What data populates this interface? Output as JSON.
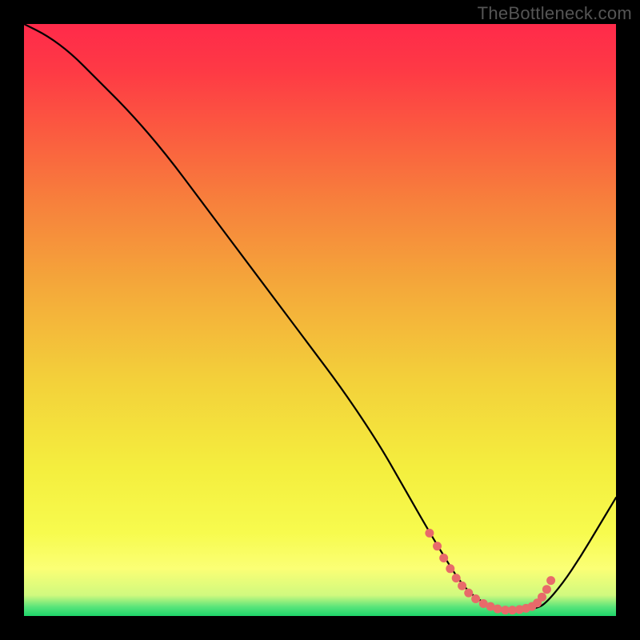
{
  "watermark": "TheBottleneck.com",
  "chart_data": {
    "type": "line",
    "title": "",
    "xlabel": "",
    "ylabel": "",
    "xlim": [
      0,
      100
    ],
    "ylim": [
      0,
      100
    ],
    "background": {
      "stops": [
        {
          "t": 0.0,
          "color": "#ff2a4a"
        },
        {
          "t": 0.08,
          "color": "#fe3a45"
        },
        {
          "t": 0.18,
          "color": "#fb5a40"
        },
        {
          "t": 0.3,
          "color": "#f7803c"
        },
        {
          "t": 0.45,
          "color": "#f4aa3a"
        },
        {
          "t": 0.6,
          "color": "#f3d03a"
        },
        {
          "t": 0.75,
          "color": "#f4ee3e"
        },
        {
          "t": 0.86,
          "color": "#f7fb4e"
        },
        {
          "t": 0.92,
          "color": "#fbff75"
        },
        {
          "t": 0.965,
          "color": "#d0f97f"
        },
        {
          "t": 0.985,
          "color": "#57e47a"
        },
        {
          "t": 1.0,
          "color": "#1ed56a"
        }
      ]
    },
    "curve": {
      "color": "#000000",
      "width": 2.2,
      "x": [
        0,
        4,
        8,
        12,
        18,
        24,
        30,
        36,
        42,
        48,
        54,
        60,
        64,
        68,
        71,
        73.5,
        76,
        79,
        82,
        84.5,
        86.5,
        88,
        91,
        94,
        97,
        100
      ],
      "y": [
        100,
        98,
        95,
        91,
        85,
        78,
        70,
        62,
        54,
        46,
        38,
        29,
        22,
        15,
        10,
        6,
        3.2,
        1.6,
        1.0,
        1.0,
        1.3,
        2.0,
        5.5,
        10,
        15,
        20
      ]
    },
    "valley_dots": {
      "color": "#e86a6a",
      "radius": 5.5,
      "points_x": [
        68.5,
        69.8,
        70.9,
        72.0,
        73.0,
        74.0,
        75.1,
        76.3,
        77.6,
        78.8,
        80.0,
        81.3,
        82.5,
        83.7,
        84.8,
        85.8,
        86.7,
        87.5,
        88.3,
        89.0
      ],
      "points_y": [
        14.0,
        11.8,
        9.8,
        8.0,
        6.4,
        5.1,
        3.9,
        2.9,
        2.1,
        1.6,
        1.2,
        1.0,
        1.0,
        1.1,
        1.3,
        1.6,
        2.2,
        3.2,
        4.5,
        6.0
      ]
    }
  }
}
